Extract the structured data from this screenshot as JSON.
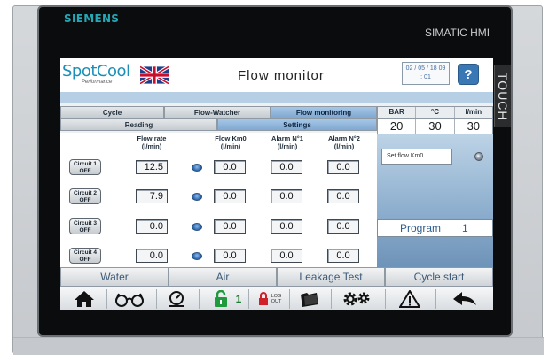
{
  "device": {
    "brand": "SIEMENS",
    "model": "SIMATIC HMI",
    "touch_label": "TOUCH"
  },
  "header": {
    "logo_main": "SpotCool",
    "logo_sub": "Performance",
    "title": "Flow monitor",
    "date_line1": "02 / 05 / 18 09",
    "date_line2": ": 01",
    "help_label": "?"
  },
  "tabs": {
    "row1": [
      "Cycle",
      "Flow-Watcher",
      "Flow monitoring"
    ],
    "row2": [
      "Reading",
      "Settings"
    ],
    "active": "Flow monitoring"
  },
  "readout": {
    "headers": [
      "BAR",
      "°C",
      "l/min"
    ],
    "values": [
      "20",
      "30",
      "30"
    ]
  },
  "settings_panel": {
    "set_flow_label": "Set flow Km0",
    "program_label": "Program",
    "program_value": "1"
  },
  "table": {
    "columns": [
      "Flow rate\n(l/min)",
      "Flow Km0\n(l/min)",
      "Alarm N°1\n(l/min)",
      "Alarm N°2\n(l/min)"
    ],
    "rows": [
      {
        "circuit": "Circuit 1",
        "state": "OFF",
        "flow_rate": "12.5",
        "flow_km0": "0.0",
        "alarm1": "0.0",
        "alarm2": "0.0"
      },
      {
        "circuit": "Circuit 2",
        "state": "OFF",
        "flow_rate": "7.9",
        "flow_km0": "0.0",
        "alarm1": "0.0",
        "alarm2": "0.0"
      },
      {
        "circuit": "Circuit 3",
        "state": "OFF",
        "flow_rate": "0.0",
        "flow_km0": "0.0",
        "alarm1": "0.0",
        "alarm2": "0.0"
      },
      {
        "circuit": "Circuit 4",
        "state": "OFF",
        "flow_rate": "0.0",
        "flow_km0": "0.0",
        "alarm1": "0.0",
        "alarm2": "0.0"
      }
    ]
  },
  "bottom_buttons": [
    "Water",
    "Air",
    "Leakage Test",
    "Cycle start"
  ],
  "toolbar": {
    "user_level": "1",
    "logout_line1": "LOG",
    "logout_line2": "OUT",
    "icons": [
      "home-icon",
      "glasses-icon",
      "gauge-icon",
      "unlock-icon",
      "logout-lock-icon",
      "folder-icon",
      "gears-icon",
      "warning-icon",
      "back-arrow-icon"
    ]
  },
  "colors": {
    "accent_blue": "#7fa8d1",
    "brand_teal": "#26a7b5",
    "program_text": "#2e5f8e"
  }
}
